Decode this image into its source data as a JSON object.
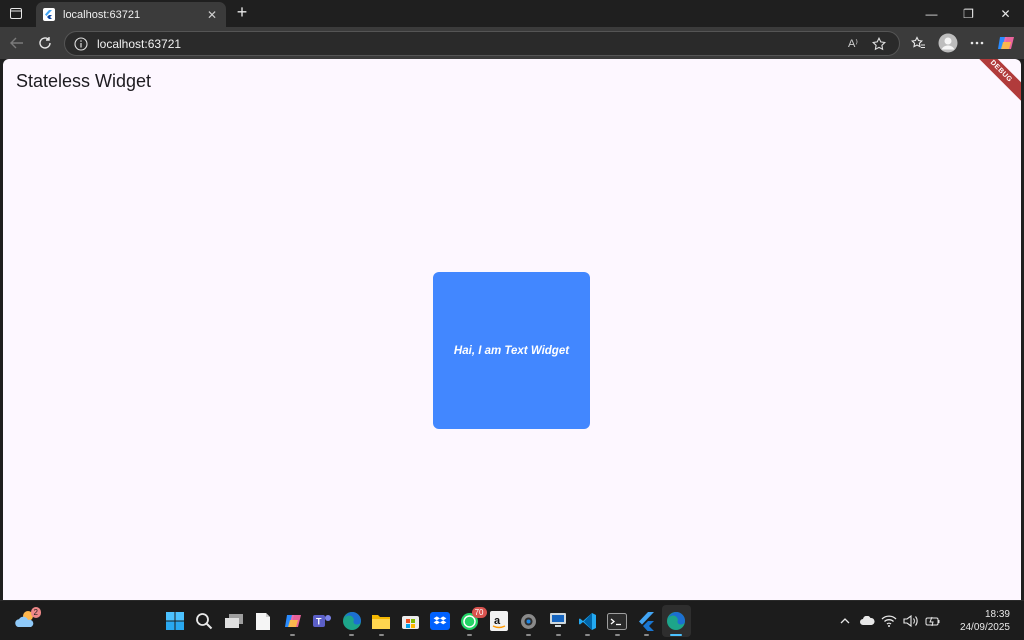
{
  "browser": {
    "tab": {
      "title": "localhost:63721",
      "close_glyph": "✕"
    },
    "new_tab_glyph": "+",
    "window_controls": {
      "minimize": "—",
      "restore": "❐",
      "close": "✕"
    },
    "address": {
      "url": "localhost:63721",
      "read_aloud": "A⁾"
    }
  },
  "page": {
    "appbar_title": "Stateless Widget",
    "debug_banner": "DEBUG",
    "box_text": "Hai, I am Text Widget",
    "box_color": "#4287ff",
    "background": "#fdf7ff"
  },
  "taskbar": {
    "weather_badge": "2",
    "whatsapp_badge": "70",
    "apps": [
      "start-icon",
      "search-icon",
      "task-view-icon",
      "notepad-icon",
      "copilot-icon",
      "teams-icon",
      "edge-icon",
      "file-explorer-icon",
      "store-icon",
      "dropbox-icon",
      "whatsapp-icon",
      "amazon-icon",
      "settings-icon",
      "remote-desktop-icon",
      "vscode-icon",
      "terminal-icon",
      "flutter-icon",
      "edge-active-icon"
    ],
    "clock": {
      "time": "18:39",
      "date": "24/09/2025"
    }
  }
}
